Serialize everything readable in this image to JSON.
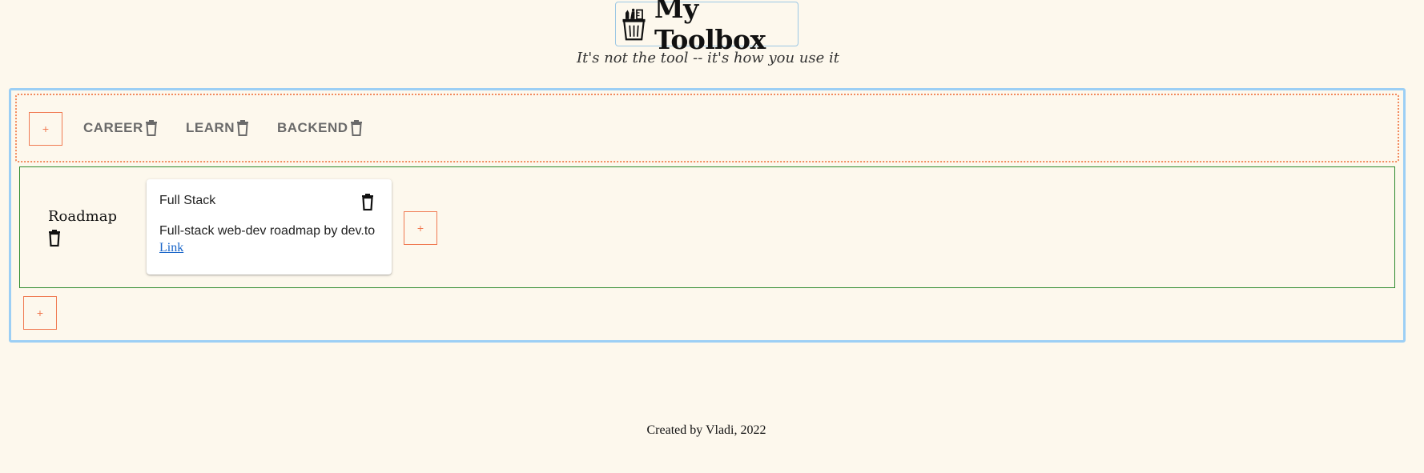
{
  "header": {
    "title": "My Toolbox",
    "tagline": "It's not the tool -- it's how you use it",
    "logo_icon": "toolbox-cup-icon"
  },
  "tabs_bar": {
    "add_label": "+",
    "tabs": [
      {
        "label": "CAREER"
      },
      {
        "label": "LEARN"
      },
      {
        "label": "BACKEND"
      }
    ],
    "trash_icon": "trash-icon"
  },
  "category": {
    "title": "Roadmap",
    "add_label": "+",
    "cards": [
      {
        "title": "Full Stack",
        "description": "Full-stack web-dev roadmap by dev.to",
        "link_label": "Link"
      }
    ]
  },
  "board": {
    "add_category_label": "+"
  },
  "footer": {
    "text": "Created by Vladi, 2022"
  },
  "colors": {
    "background": "#fdf8ed",
    "board_border": "#9ccff5",
    "tabs_border": "#f28a5e",
    "category_border": "#2e8b2e",
    "add_button": "#f07a52",
    "link": "#1a66c9"
  }
}
